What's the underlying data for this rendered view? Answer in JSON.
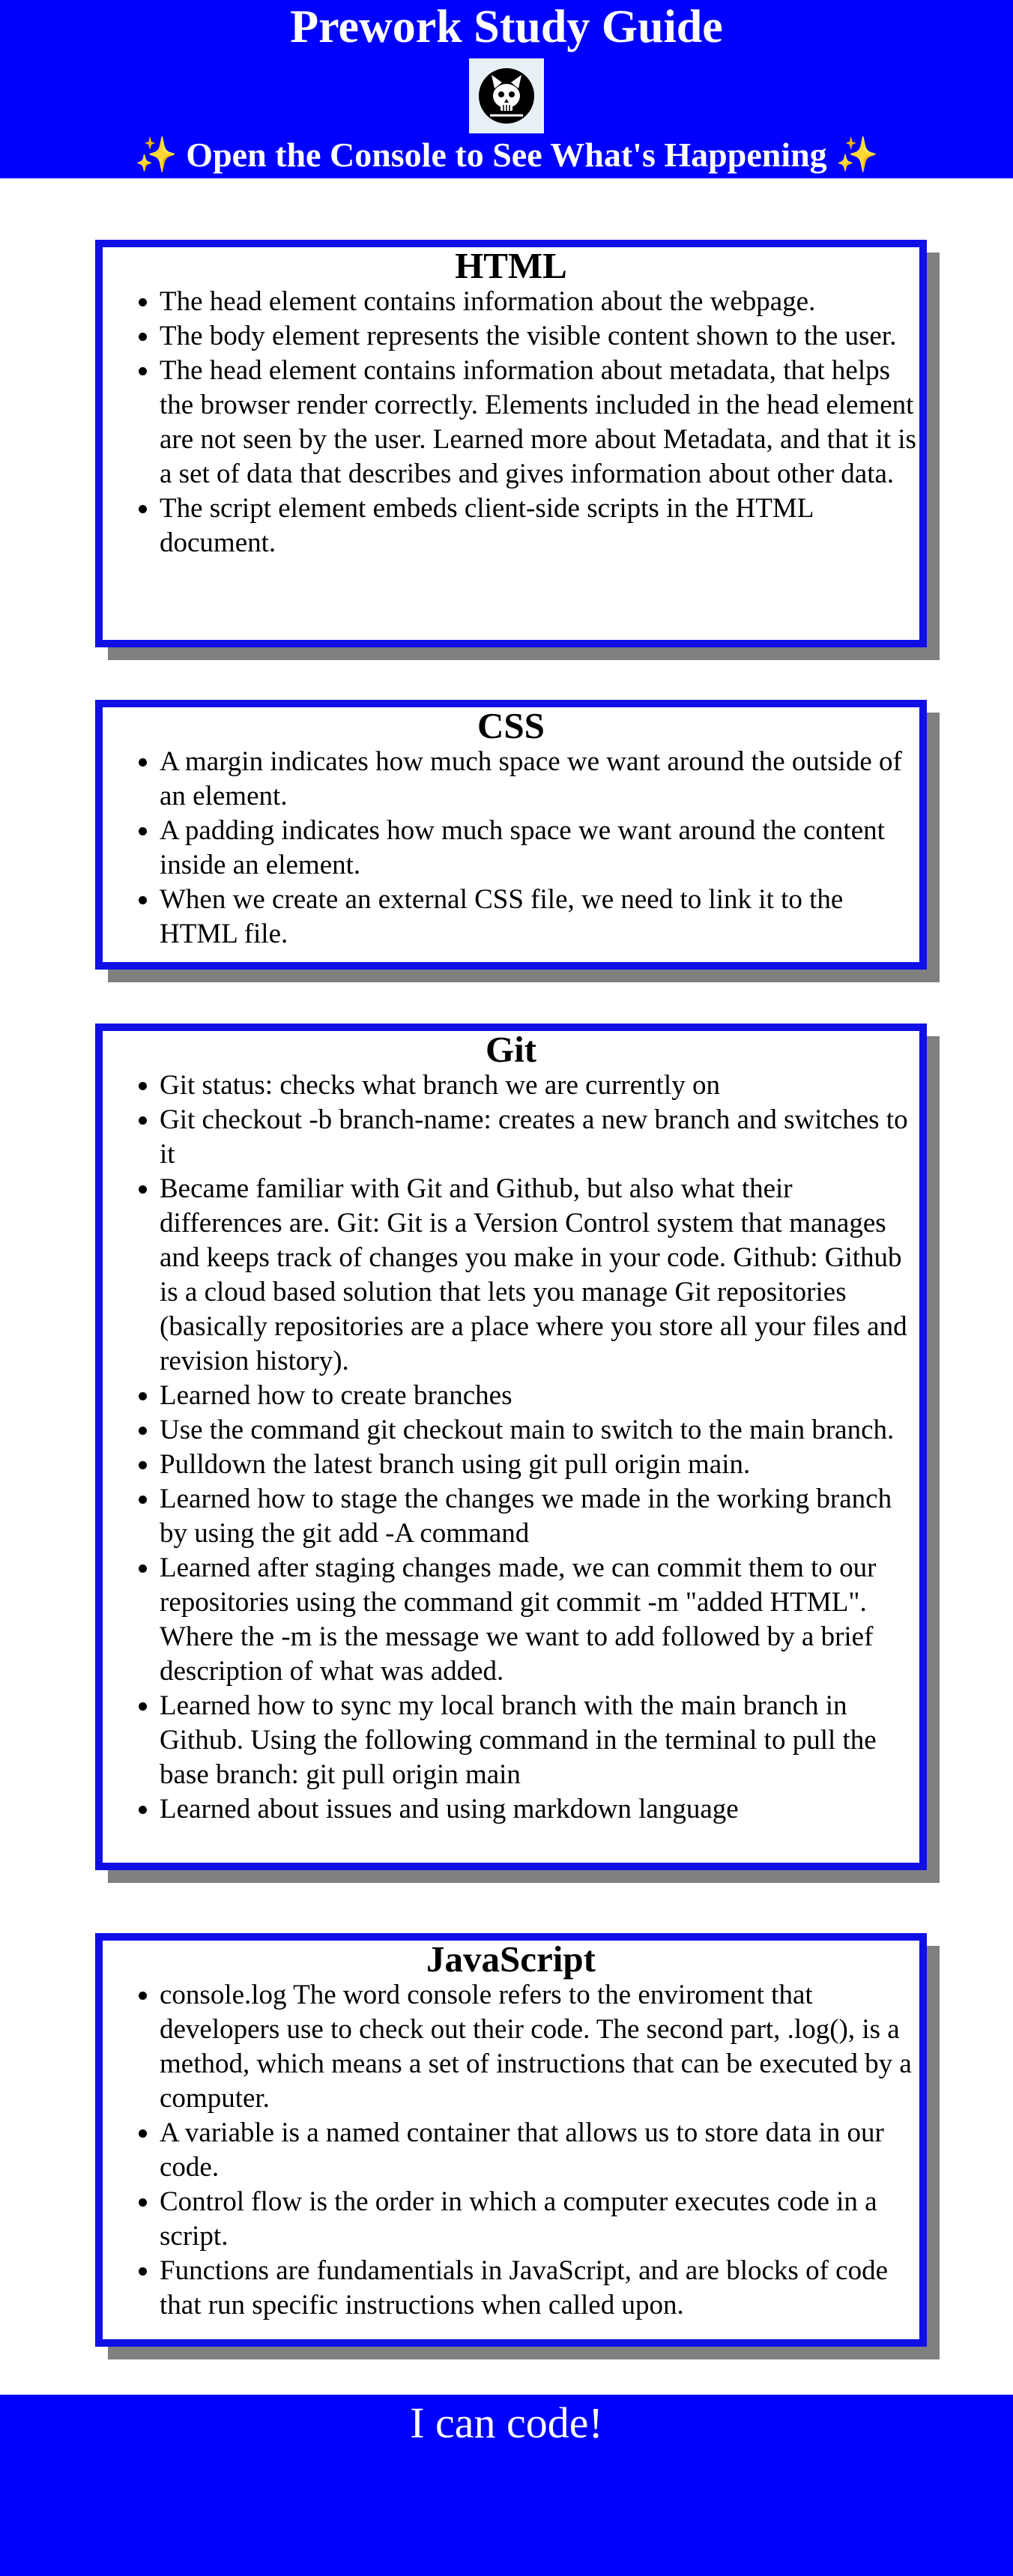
{
  "header": {
    "title": "Prework Study Guide",
    "subtitle_text": "Open the Console to See What's Happening",
    "sparkle": "✨",
    "avatar_icon": "cat-skull-icon"
  },
  "sections": {
    "html": {
      "title": "HTML",
      "items": [
        "The head element contains information about the webpage.",
        "The body element represents the visible content shown to the user.",
        "The head element contains information about metadata, that helps the browser render correctly. Elements included in the head element are not seen by the user. Learned more about Metadata, and that it is a set of data that describes and gives information about other data.",
        "The script element embeds client-side scripts in the HTML document."
      ]
    },
    "css": {
      "title": "CSS",
      "items": [
        "A margin indicates how much space we want around the outside of an element.",
        "A padding indicates how much space we want around the content inside an element.",
        "When we create an external CSS file, we need to link it to the HTML file."
      ]
    },
    "git": {
      "title": "Git",
      "items": [
        "Git status: checks what branch we are currently on",
        "Git checkout -b branch-name: creates a new branch and switches to it",
        "Became familiar with Git and Github, but also what their differences are. Git: Git is a Version Control system that manages and keeps track of changes you make in your code. Github: Github is a cloud based solution that lets you manage Git repositories (basically repositories are a place where you store all your files and revision history).",
        "Learned how to create branches",
        "Use the command git checkout main to switch to the main branch.",
        "Pulldown the latest branch using git pull origin main.",
        "Learned how to stage the changes we made in the working branch by using the git add -A command",
        "Learned after staging changes made, we can commit them to our repositories using the command git commit -m \"added HTML\". Where the -m is the message we want to add followed by a brief description of what was added.",
        "Learned how to sync my local branch with the main branch in Github. Using the following command in the terminal to pull the base branch: git pull origin main",
        "Learned about issues and using markdown language"
      ]
    },
    "javascript": {
      "title": "JavaScript",
      "items": [
        "console.log The word console refers to the enviroment that developers use to check out their code. The second part, .log(), is a method, which means a set of instructions that can be executed by a computer.",
        "A variable is a named container that allows us to store data in our code.",
        "Control flow is the order in which a computer executes code in a script.",
        "Functions are fundamentials in JavaScript, and are blocks of code that run specific instructions when called upon."
      ]
    }
  },
  "footer": {
    "text": "I can code!"
  },
  "colors": {
    "banner": "#0000ff",
    "card_border": "#1010e6",
    "card_shadow": "#808080",
    "sparkle": "#ffd83a"
  }
}
